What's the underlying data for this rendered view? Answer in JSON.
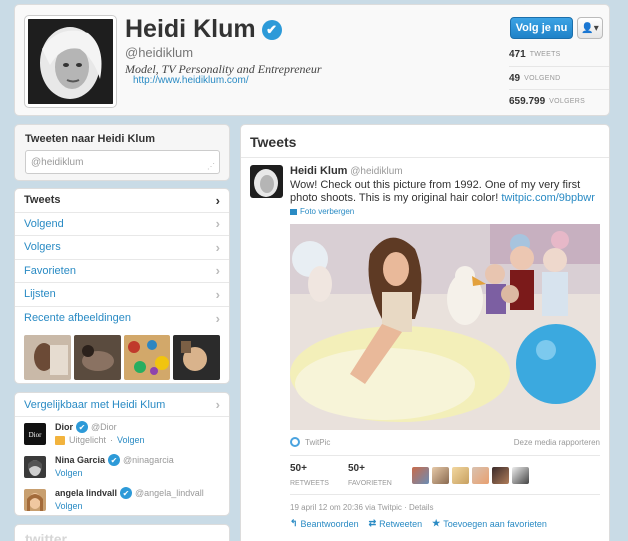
{
  "profile": {
    "name": "Heidi Klum",
    "handle": "@heidiklum",
    "bio": "Model, TV Personality and Entrepreneur",
    "url": "http://www.heidiklum.com/",
    "follow_label": "Volg je nu",
    "user_menu_icon": "user-dropdown-icon",
    "stats": [
      {
        "value": "471",
        "label": "TWEETS"
      },
      {
        "value": "49",
        "label": "VOLGEND"
      },
      {
        "value": "659.799",
        "label": "VOLGERS"
      }
    ]
  },
  "tweet_to": {
    "title": "Tweeten naar Heidi Klum",
    "value": "@heidiklum"
  },
  "nav": {
    "items": [
      {
        "label": "Tweets"
      },
      {
        "label": "Volgend"
      },
      {
        "label": "Volgers"
      },
      {
        "label": "Favorieten"
      },
      {
        "label": "Lijsten"
      },
      {
        "label": "Recente afbeeldingen"
      }
    ]
  },
  "similar": {
    "title": "Vergelijkbaar met Heidi Klum",
    "users": [
      {
        "name": "Dior",
        "handle": "@Dior",
        "status": "Uitgelicht",
        "sep": "·",
        "action": "Volgen",
        "verified": true,
        "avatar_text": "Dior"
      },
      {
        "name": "Nina Garcia",
        "handle": "@ninagarcia",
        "action": "Volgen",
        "verified": true
      },
      {
        "name": "angela lindvall",
        "handle": "@angela_lindvall",
        "action": "Volgen",
        "verified": true
      }
    ]
  },
  "footer": {
    "logo": "twitter"
  },
  "tweets": {
    "heading": "Tweets",
    "tweet": {
      "author": "Heidi Klum",
      "handle": "@heidiklum",
      "text": "Wow! Check out this picture from 1992. One of my very first photo shoots. This is my original hair color! ",
      "link": "twitpic.com/9bpbwr",
      "hide_photo": "Foto verbergen",
      "media_source": "TwitPic",
      "report": "Deze media rapporteren",
      "retweets": {
        "value": "50+",
        "label": "RETWEETS"
      },
      "favorites": {
        "value": "50+",
        "label": "FAVORIETEN"
      },
      "meta": "19 april 12 om 20:36 via Twitpic · Details",
      "actions": [
        {
          "icon": "reply-icon",
          "glyph": "↰",
          "label": "Beantwoorden"
        },
        {
          "icon": "retweet-icon",
          "glyph": "⇄",
          "label": "Retweeten"
        },
        {
          "icon": "star-icon",
          "glyph": "★",
          "label": "Toevoegen aan favorieten"
        }
      ]
    }
  },
  "colors": {
    "accent": "#2a8bc4",
    "background": "#c9dbe6",
    "follow": "#2d8fd5",
    "verified": "#2d9ad8"
  }
}
